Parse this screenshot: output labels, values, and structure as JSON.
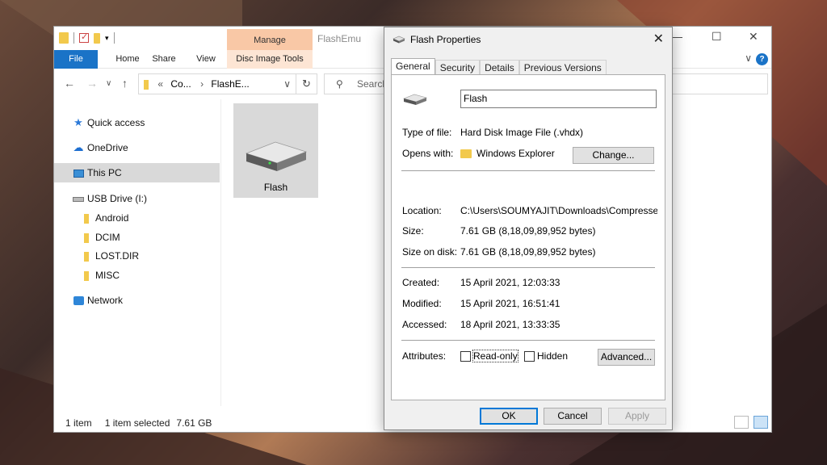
{
  "explorer": {
    "window_title": "FlashEmu",
    "manage_tab": "Manage",
    "ribbon_tabs": [
      "File",
      "Home",
      "Share",
      "View"
    ],
    "disc_tools_tab": "Disc Image Tools",
    "address": {
      "ellipsis": "«",
      "crumb1": "Co...",
      "crumb2": "FlashE..."
    },
    "search_placeholder": "Search",
    "nav": {
      "quick_access": "Quick access",
      "onedrive": "OneDrive",
      "this_pc": "This PC",
      "usb_drive": "USB Drive (I:)",
      "folders": [
        "Android",
        "DCIM",
        "LOST.DIR",
        "MISC"
      ],
      "network": "Network"
    },
    "file": {
      "name": "Flash"
    },
    "status": {
      "count": "1 item",
      "selected": "1 item selected",
      "size": "7.61 GB"
    }
  },
  "dialog": {
    "title": "Flash Properties",
    "tabs": [
      "General",
      "Security",
      "Details",
      "Previous Versions"
    ],
    "name_value": "Flash",
    "labels": {
      "type": "Type of file:",
      "opens": "Opens with:",
      "location": "Location:",
      "size": "Size:",
      "size_on_disk": "Size on disk:",
      "created": "Created:",
      "modified": "Modified:",
      "accessed": "Accessed:",
      "attributes": "Attributes:"
    },
    "values": {
      "type": "Hard Disk Image File (.vhdx)",
      "opens": "Windows Explorer",
      "location": "C:\\Users\\SOUMYAJIT\\Downloads\\Compressed\\Fla",
      "size": "7.61 GB (8,18,09,89,952 bytes)",
      "size_on_disk": "7.61 GB (8,18,09,89,952 bytes)",
      "created": "15 April 2021, 12:03:33",
      "modified": "15 April 2021, 16:51:41",
      "accessed": "18 April 2021, 13:33:35"
    },
    "buttons": {
      "change": "Change...",
      "advanced": "Advanced...",
      "ok": "OK",
      "cancel": "Cancel",
      "apply": "Apply"
    },
    "attributes": {
      "readonly": "Read-only",
      "hidden": "Hidden",
      "readonly_checked": false,
      "hidden_checked": false
    }
  },
  "colors": {
    "accent": "#1a73c7",
    "manage_tab": "#f9c8a6",
    "selection": "#d9d9d9"
  }
}
